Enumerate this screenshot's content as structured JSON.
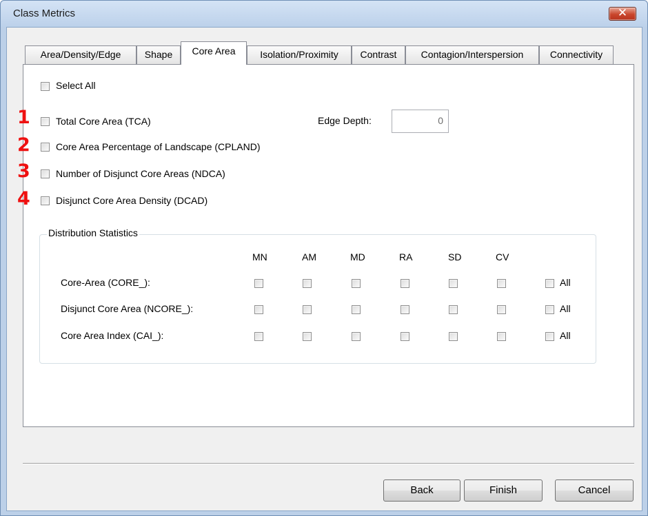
{
  "window": {
    "title": "Class Metrics",
    "close_glyph": "✕"
  },
  "tabs": [
    {
      "label": "Area/Density/Edge",
      "active": false
    },
    {
      "label": "Shape",
      "active": false
    },
    {
      "label": "Core Area",
      "active": true
    },
    {
      "label": "Isolation/Proximity",
      "active": false
    },
    {
      "label": "Contrast",
      "active": false
    },
    {
      "label": "Contagion/Interspersion",
      "active": false
    },
    {
      "label": "Connectivity",
      "active": false
    }
  ],
  "select_all_label": "Select All",
  "metrics": [
    {
      "number": "1",
      "label": "Total Core Area (TCA)",
      "checked": false
    },
    {
      "number": "2",
      "label": "Core Area Percentage of Landscape (CPLAND)",
      "checked": false
    },
    {
      "number": "3",
      "label": "Number of Disjunct Core Areas (NDCA)",
      "checked": false
    },
    {
      "number": "4",
      "label": "Disjunct Core Area Density (DCAD)",
      "checked": false
    }
  ],
  "edge_depth": {
    "label": "Edge Depth:",
    "value": "0"
  },
  "distribution": {
    "title": "Distribution Statistics",
    "columns": [
      "MN",
      "AM",
      "MD",
      "RA",
      "SD",
      "CV"
    ],
    "all_label": "All",
    "rows": [
      {
        "label": "Core-Area (CORE_):"
      },
      {
        "label": "Disjunct Core Area (NCORE_):"
      },
      {
        "label": "Core Area Index (CAI_):"
      }
    ]
  },
  "buttons": {
    "back": "Back",
    "finish": "Finish",
    "cancel": "Cancel"
  }
}
